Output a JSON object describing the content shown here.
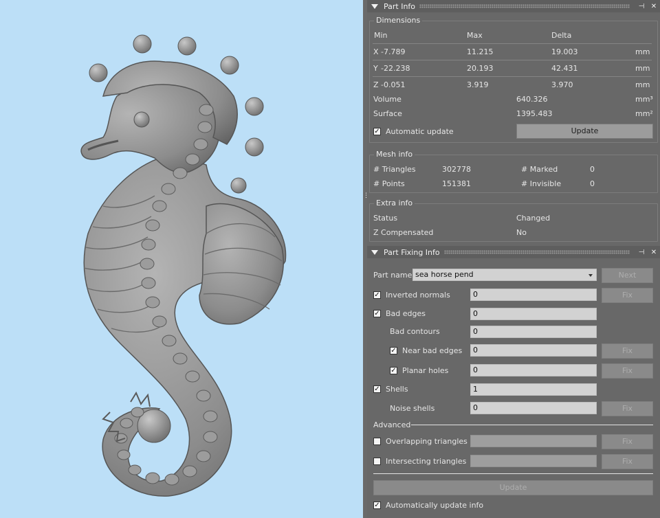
{
  "part_info": {
    "title": "Part Info",
    "dimensions": {
      "legend": "Dimensions",
      "headers": {
        "min": "Min",
        "max": "Max",
        "delta": "Delta"
      },
      "rows": [
        {
          "axis": "X",
          "min": "-7.789",
          "max": "11.215",
          "delta": "19.003",
          "unit": "mm"
        },
        {
          "axis": "Y",
          "min": "-22.238",
          "max": "20.193",
          "delta": "42.431",
          "unit": "mm"
        },
        {
          "axis": "Z",
          "min": "-0.051",
          "max": "3.919",
          "delta": "3.970",
          "unit": "mm"
        }
      ],
      "volume_label": "Volume",
      "volume_value": "640.326",
      "volume_unit": "mm³",
      "surface_label": "Surface",
      "surface_value": "1395.483",
      "surface_unit": "mm²",
      "auto_update_label": "Automatic update",
      "auto_update_checked": true,
      "update_button": "Update"
    },
    "mesh_info": {
      "legend": "Mesh info",
      "triangles_label": "# Triangles",
      "triangles_value": "302778",
      "points_label": "# Points",
      "points_value": "151381",
      "marked_label": "# Marked",
      "marked_value": "0",
      "invisible_label": "# Invisible",
      "invisible_value": "0"
    },
    "extra_info": {
      "legend": "Extra info",
      "status_label": "Status",
      "status_value": "Changed",
      "zcomp_label": "Z Compensated",
      "zcomp_value": "No"
    }
  },
  "part_fixing": {
    "title": "Part Fixing Info",
    "part_name_label": "Part name",
    "part_name_value": "sea horse pend",
    "next_button": "Next",
    "fix_button": "Fix",
    "inverted_normals_label": "Inverted normals",
    "inverted_normals_value": "0",
    "bad_edges_label": "Bad edges",
    "bad_edges_value": "0",
    "bad_contours_label": "Bad contours",
    "bad_contours_value": "0",
    "near_bad_edges_label": "Near bad edges",
    "near_bad_edges_value": "0",
    "planar_holes_label": "Planar holes",
    "planar_holes_value": "0",
    "shells_label": "Shells",
    "shells_value": "1",
    "noise_shells_label": "Noise shells",
    "noise_shells_value": "0",
    "advanced_label": "Advanced",
    "overlapping_label": "Overlapping triangles",
    "intersecting_label": "Intersecting triangles",
    "update_button": "Update",
    "auto_update_info_label": "Automatically update info"
  },
  "icons": {
    "pin": "⊣",
    "close": "✕",
    "check": "✓",
    "splitter_grip": "⋮"
  },
  "colors": {
    "viewport_bg": "#bcdff7",
    "panel_bg": "#686868",
    "model_gray": "#8e8e8e"
  }
}
